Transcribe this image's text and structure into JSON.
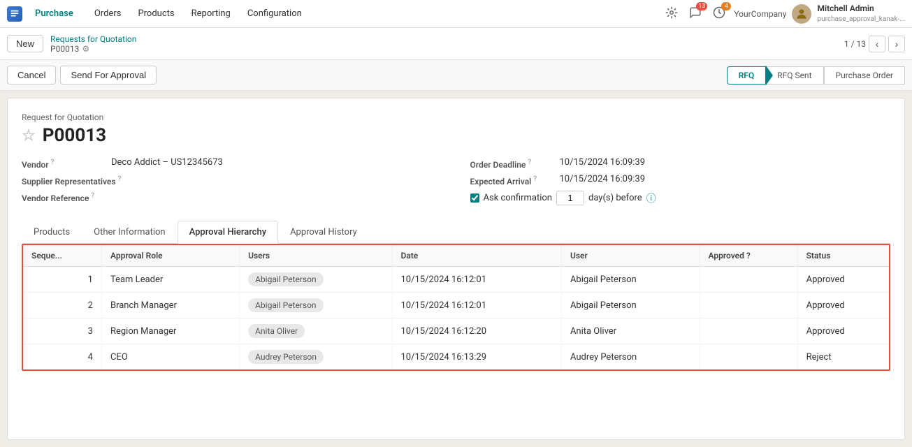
{
  "topNav": {
    "brand": "Purchase",
    "items": [
      "Orders",
      "Products",
      "Reporting",
      "Configuration"
    ],
    "notifications": {
      "bell": "",
      "chat_count": "13",
      "activity_count": "4"
    },
    "company": "YourCompany",
    "user": {
      "name": "Mitchell Admin",
      "role": "purchase_approval_kanak-..."
    }
  },
  "breadcrumb": {
    "new_label": "New",
    "parent": "Requests for Quotation",
    "current": "P00013",
    "counter": "1 / 13"
  },
  "actionBar": {
    "cancel_label": "Cancel",
    "send_label": "Send For Approval",
    "pipeline": [
      {
        "label": "RFQ",
        "active": true
      },
      {
        "label": "RFQ Sent",
        "active": false
      },
      {
        "label": "Purchase Order",
        "active": false
      }
    ]
  },
  "form": {
    "title_small": "Request for Quotation",
    "title_large": "P00013",
    "vendor_label": "Vendor",
    "vendor_help": "?",
    "vendor_value": "Deco Addict – US12345673",
    "supplier_label": "Supplier Representatives",
    "supplier_help": "?",
    "vendor_ref_label": "Vendor Reference",
    "vendor_ref_help": "?",
    "order_deadline_label": "Order Deadline",
    "order_deadline_help": "?",
    "order_deadline_value": "10/15/2024 16:09:39",
    "expected_arrival_label": "Expected Arrival",
    "expected_arrival_help": "?",
    "expected_arrival_value": "10/15/2024 16:09:39",
    "ask_confirmation_label": "Ask confirmation",
    "ask_confirmation_days": "1",
    "days_before_label": "day(s) before"
  },
  "tabs": [
    {
      "label": "Products",
      "active": false
    },
    {
      "label": "Other Information",
      "active": false
    },
    {
      "label": "Approval Hierarchy",
      "active": true
    },
    {
      "label": "Approval History",
      "active": false
    }
  ],
  "table": {
    "headers": [
      "Seque...",
      "Approval Role",
      "Users",
      "Date",
      "User",
      "Approved ?",
      "Status"
    ],
    "rows": [
      {
        "seq": "1",
        "role": "Team Leader",
        "user_badge": "Abigail Peterson",
        "date": "10/15/2024 16:12:01",
        "user": "Abigail Peterson",
        "approved": "",
        "status": "Approved",
        "status_class": "approved"
      },
      {
        "seq": "2",
        "role": "Branch Manager",
        "user_badge": "Abigail Peterson",
        "date": "10/15/2024 16:12:01",
        "user": "Abigail Peterson",
        "approved": "",
        "status": "Approved",
        "status_class": "approved"
      },
      {
        "seq": "3",
        "role": "Region Manager",
        "user_badge": "Anita Oliver",
        "date": "10/15/2024 16:12:20",
        "user": "Anita Oliver",
        "approved": "",
        "status": "Approved",
        "status_class": "approved"
      },
      {
        "seq": "4",
        "role": "CEO",
        "user_badge": "Audrey Peterson",
        "date": "10/15/2024 16:13:29",
        "user": "Audrey Peterson",
        "approved": "",
        "status": "Reject",
        "status_class": "reject"
      }
    ]
  }
}
